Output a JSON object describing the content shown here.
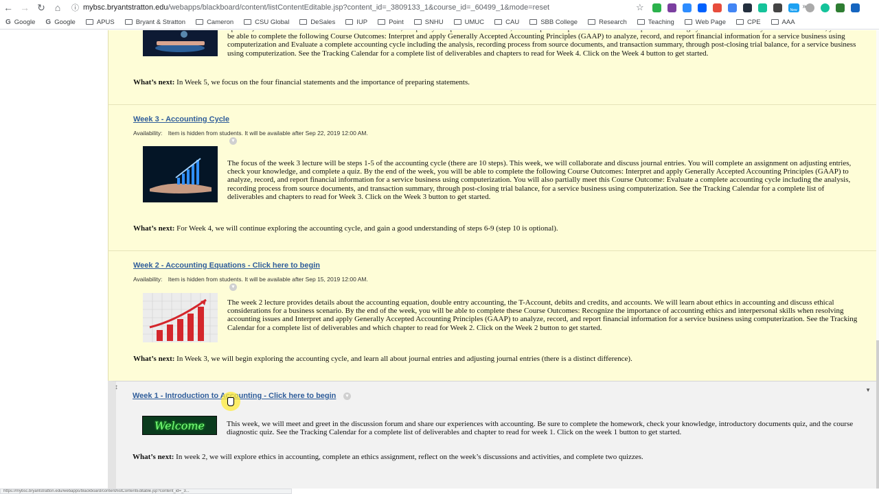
{
  "browser": {
    "url_host": "mybsc.bryantstratton.edu",
    "url_path": "/webapps/blackboard/content/listContentEditable.jsp?content_id=_3809133_1&course_id=_60499_1&mode=reset",
    "bookmarks": [
      "Google",
      "Google",
      "APUS",
      "Bryant & Stratton",
      "Cameron",
      "CSU Global",
      "DeSales",
      "IUP",
      "Point",
      "SNHU",
      "UMUC",
      "CAU",
      "SBB College",
      "Research",
      "Teaching",
      "Web Page",
      "CPE",
      "AAA"
    ],
    "bookmarks_more": "»",
    "extension_badge": "New",
    "status_url": "https://mybsc.bryantstratton.edu/webapps/blackboard/content/listContentEditable.jsp?content_id=_3..."
  },
  "items": [
    {
      "id": "week4-tail",
      "desc": "optional). We will learn about the benefits of a worksheet, temporary and permanent accounts, and complete a report to evaluate the complete accounting cycle for a business. By the end of the week, you will be able to complete the following Course Outcomes: Interpret and apply Generally Accepted Accounting Principles (GAAP) to analyze, record, and report financial information for a service business using computerization and Evaluate a complete accounting cycle including the analysis, recording process from source documents, and transaction summary, through post-closing trial balance, for a service business using computerization. See the Tracking Calendar for a complete list of deliverables and chapters to read for Week 4. Click on the Week 4 button to get started.",
      "next_label": "What’s next:",
      "next_text": " In Week 5, we focus on the four financial statements and the importance of preparing statements."
    },
    {
      "id": "week3",
      "title": "Week 3 - Accounting Cycle",
      "availability_label": "Availability:",
      "availability_text": "Item is hidden from students. It will be available after Sep 22, 2019 12:00 AM.",
      "desc": "The focus of the week 3 lecture will be steps 1-5 of the accounting cycle (there are 10 steps). This week, we will collaborate and discuss journal entries. You will complete an assignment on adjusting entries, check your knowledge, and complete a quiz. By the end of the week, you will be able to complete the following Course Outcomes: Interpret and apply Generally Accepted Accounting Principles (GAAP) to analyze, record, and report financial information for a service business using computerization.  You will also partially meet this Course Outcome:  Evaluate a complete accounting cycle including the analysis, recording process from source documents, and transaction summary, through post-closing trial balance, for a service business using computerization. See the Tracking Calendar for a complete list of deliverables and chapters to read for Week 3. Click on the Week 3 button to get started.",
      "next_label": "What’s next:",
      "next_text": " For Week 4, we will continue exploring the accounting cycle, and gain a good understanding of steps 6-9 (step 10 is optional)."
    },
    {
      "id": "week2",
      "title": "Week 2 - Accounting Equations - Click here to begin",
      "availability_label": "Availability:",
      "availability_text": "Item is hidden from students. It will be available after Sep 15, 2019 12:00 AM.",
      "desc": "The week 2 lecture provides details about the accounting equation, double entry accounting, the T-Account, debits and credits, and accounts. We will learn about ethics in accounting and discuss ethical considerations for a business scenario. By the end of the week, you will be able to complete these Course Outcomes: Recognize the importance of accounting ethics and interpersonal skills when resolving accounting issues and Interpret and apply Generally Accepted Accounting Principles (GAAP) to analyze, record, and report financial information for a service business using computerization. See the Tracking Calendar for a complete list of deliverables and which chapter to read for Week 2. Click on the Week 2 button to get started.",
      "next_label": "What’s next:",
      "next_text": " In Week 3, we will begin exploring the accounting cycle, and learn all about journal entries and adjusting journal entries (there is a distinct difference)."
    },
    {
      "id": "week1",
      "title": "Week 1 - Introduction to Accounting - Click here to begin",
      "thumb_text": "Welcome",
      "desc": "This week, we will meet and greet in the discussion forum and share our experiences with accounting. Be sure to complete the homework, check your knowledge, introductory documents quiz, and the course diagnostic quiz.  See the Tracking Calendar for a complete list of deliverables and chapter to read for week 1. Click on the week 1 button to get started.",
      "next_label": "What’s next:",
      "next_text": " In week 2, we will explore ethics in accounting, complete an ethics assignment, reflect on the week’s discussions and activities, and complete two quizzes."
    }
  ]
}
